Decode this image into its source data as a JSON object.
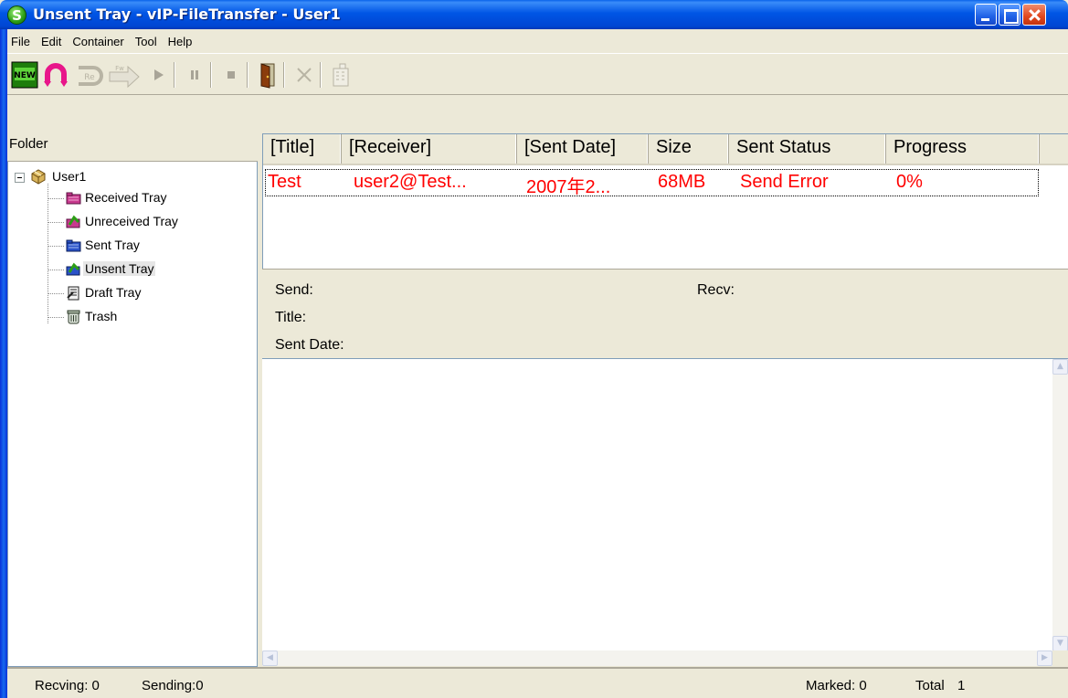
{
  "window": {
    "title": "Unsent Tray - vIP-FileTransfer - User1"
  },
  "menu": [
    "File",
    "Edit",
    "Container",
    "Tool",
    "Help"
  ],
  "toolbar": {
    "buttons": [
      {
        "name": "new-button",
        "label": "NEW"
      },
      {
        "name": "reply-button",
        "label": "Re"
      },
      {
        "name": "forward-button",
        "label": "Fw"
      }
    ]
  },
  "folder_panel": {
    "header": "Folder",
    "root": "User1",
    "items": [
      {
        "label": "Received Tray",
        "icon": "folder-received-icon"
      },
      {
        "label": "Unreceived Tray",
        "icon": "folder-unreceived-icon"
      },
      {
        "label": "Sent Tray",
        "icon": "folder-sent-icon"
      },
      {
        "label": "Unsent Tray",
        "icon": "folder-unsent-icon",
        "selected": true
      },
      {
        "label": "Draft Tray",
        "icon": "draft-icon"
      },
      {
        "label": "Trash",
        "icon": "trash-icon"
      }
    ]
  },
  "list": {
    "columns": [
      "[Title]",
      "[Receiver]",
      "[Sent Date]",
      "Size",
      "Sent Status",
      "Progress"
    ],
    "rows": [
      {
        "title": "Test",
        "receiver": "user2@Test...",
        "sent_date": "2007年2...",
        "size": "68MB",
        "status": "Send Error",
        "progress": "0%"
      }
    ],
    "row_color": "#ff0000"
  },
  "detail": {
    "send_label": "Send:",
    "recv_label": "Recv:",
    "title_label": "Title:",
    "sent_date_label": "Sent Date:"
  },
  "status": {
    "recving": "Recving: 0",
    "sending": "Sending:0",
    "marked": "Marked: 0",
    "total_label": "Total",
    "total_value": "1"
  }
}
